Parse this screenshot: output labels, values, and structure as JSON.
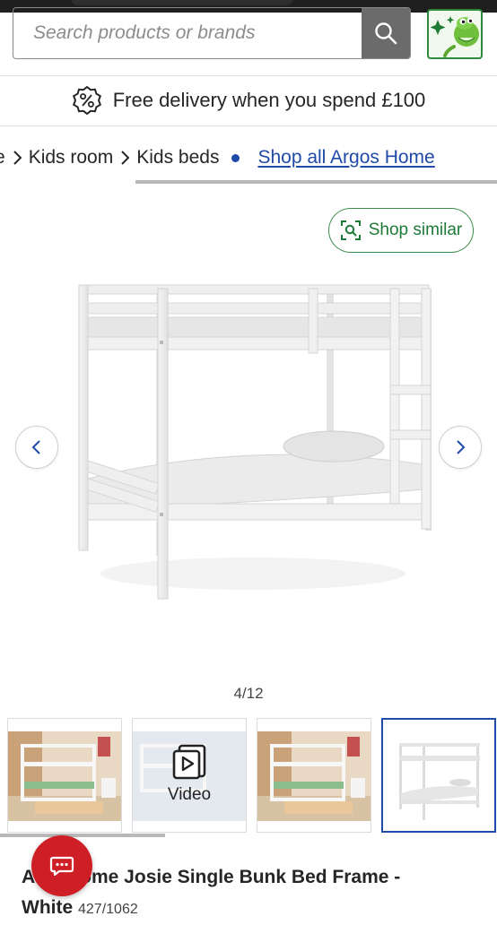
{
  "search": {
    "placeholder": "Search products or brands"
  },
  "delivery": {
    "text": "Free delivery when you spend £100"
  },
  "breadcrumb": {
    "partial": "e",
    "items": [
      "Kids room",
      "Kids beds"
    ],
    "shop_all": "Shop all Argos Home"
  },
  "shop_similar": {
    "label": "Shop similar"
  },
  "gallery": {
    "counter": "4/12",
    "video_label": "Video",
    "selected_index": 4,
    "total": 12
  },
  "product": {
    "title_start": "A",
    "title_rest": "ome Josie Single Bunk Bed Frame -",
    "title_line2": "White",
    "title_line2_suffix": "427/1062"
  },
  "colors": {
    "accent_blue": "#1f4aa8",
    "brand_green": "#1d7a37",
    "chat_red": "#cf1f26"
  },
  "icons": [
    "search-icon",
    "discount-badge-icon",
    "chevron-right-icon",
    "shop-similar-icon",
    "chevron-left-icon",
    "video-play-icon",
    "chat-icon",
    "mascot-icon"
  ]
}
